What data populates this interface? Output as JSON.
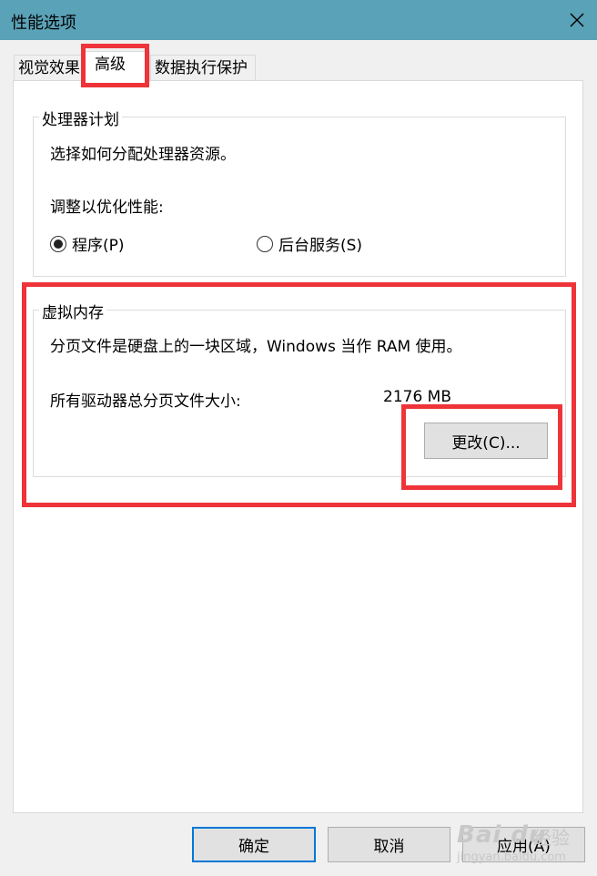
{
  "window": {
    "title": "性能选项"
  },
  "tabs": [
    {
      "label": "视觉效果"
    },
    {
      "label": "高级"
    },
    {
      "label": "数据执行保护"
    }
  ],
  "processor_group": {
    "title": "处理器计划",
    "description": "选择如何分配处理器资源。",
    "adjust_label": "调整以优化性能:",
    "options": [
      {
        "label": "程序(P)",
        "checked": true
      },
      {
        "label": "后台服务(S)",
        "checked": false
      }
    ]
  },
  "virtual_memory_group": {
    "title": "虚拟内存",
    "description": "分页文件是硬盘上的一块区域，Windows 当作 RAM 使用。",
    "total_label": "所有驱动器总分页文件大小:",
    "total_value": "2176 MB",
    "change_button": "更改(C)..."
  },
  "footer": {
    "ok": "确定",
    "cancel": "取消",
    "apply": "应用(A)"
  },
  "watermark": {
    "logo": "Bai du",
    "text": "经验",
    "url": "jingyan.baidu.com"
  },
  "colors": {
    "titlebar": "#5aa2b8",
    "highlight": "#ee3439",
    "default_button_border": "#0078d7"
  }
}
